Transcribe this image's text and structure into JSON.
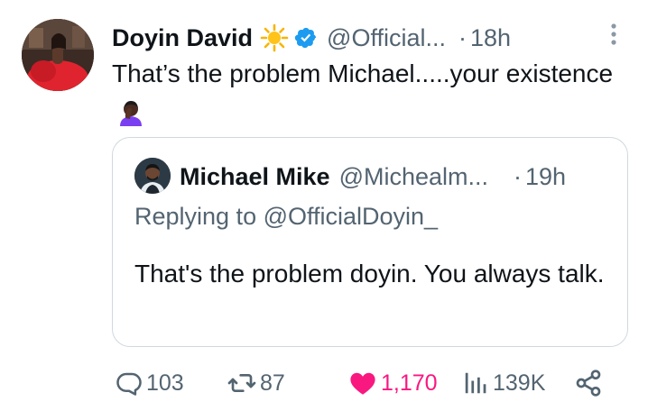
{
  "tweet": {
    "display_name": "Doyin David",
    "handle": "@Official...",
    "separator": "·",
    "time": "18h",
    "text": "That’s the problem Michael.....your existence",
    "icons": {
      "more": "more-vertical-icon",
      "badge_emoji": "sun-icon",
      "verified": "verified-badge-icon",
      "text_emoji": "woman-facepalming-icon"
    }
  },
  "quoted_tweet": {
    "display_name": "Michael Mike",
    "handle": "@Michealm...",
    "separator": "·",
    "time": "19h",
    "replying_to": "Replying to @OfficialDoyin_",
    "text": "That's the problem doyin. You always talk."
  },
  "actions": {
    "replies": "103",
    "retweets": "87",
    "likes": "1,170",
    "views": "139K",
    "like_color": "#f91880",
    "icons": [
      "reply-icon",
      "retweet-icon",
      "heart-icon",
      "views-chart-icon",
      "share-icon"
    ]
  },
  "colors": {
    "text_primary": "#0f1419",
    "text_secondary": "#536471",
    "verified_blue": "#1d9bf0",
    "border": "#cfd9de"
  }
}
